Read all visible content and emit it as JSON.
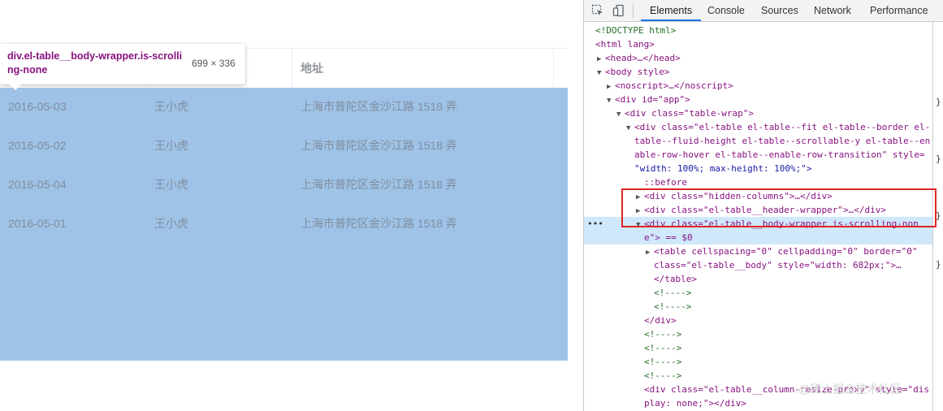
{
  "table": {
    "columns": [
      "",
      "",
      "地址"
    ],
    "rows": [
      [
        "2016-05-03",
        "王小虎",
        "上海市普陀区金沙江路 1518 弄"
      ],
      [
        "2016-05-02",
        "王小虎",
        "上海市普陀区金沙江路 1518 弄"
      ],
      [
        "2016-05-04",
        "王小虎",
        "上海市普陀区金沙江路 1518 弄"
      ],
      [
        "2016-05-01",
        "王小虎",
        "上海市普陀区金沙江路 1518 弄"
      ]
    ],
    "highlight_color": "#9fc3e7"
  },
  "tooltip": {
    "element": "div.el-table__body-wrapper.is-scrolling-none",
    "size": "699 × 336"
  },
  "devtools": {
    "tabs": [
      "Elements",
      "Console",
      "Sources",
      "Network",
      "Performance"
    ],
    "active_tab": "Elements",
    "icons": [
      "inspect-icon",
      "device-toggle-icon"
    ],
    "lines": [
      "<!DOCTYPE html>",
      "<html lang>",
      "<head>…</head>",
      "<body style>",
      "<noscript>…</noscript>",
      "<div id=\"app\">",
      "<div class=\"table-wrap\">",
      "<div class=\"el-table el-table--fit el-table--border el-",
      "table--fluid-height el-table--scrollable-y el-table--en",
      "able-row-hover el-table--enable-row-transition\" style=",
      "\"width: 100%; max-height: 100%;\">",
      "::before",
      "<div class=\"hidden-columns\">…</div>",
      "<div class=\"el-table__header-wrapper\">…</div>",
      "<div class=\"el-table__body-wrapper is-scrolling-non",
      "e\"> == $0",
      "<table cellspacing=\"0\" cellpadding=\"0\" border=\"0\"",
      "class=\"el-table__body\" style=\"width: 682px;\">…",
      "</table>",
      "<!---->",
      "<!---->",
      "</div>",
      "<!---->",
      "<!---->",
      "<!---->",
      "<!---->",
      "<div class=\"el-table__column-resize-proxy\" style=\"dis",
      "play: none;\"></div>"
    ],
    "selected_marker": "•••",
    "accent": "#1a73e8",
    "selection_outline": "#e02424"
  },
  "watermark": "@稀土掘金技术社区"
}
